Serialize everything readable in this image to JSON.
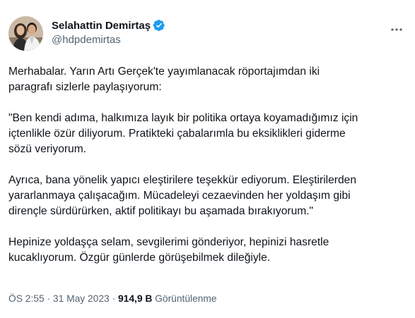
{
  "user": {
    "display_name": "Selahattin Demirtaş",
    "handle": "@hdpdemirtas"
  },
  "tweet": {
    "paragraphs": [
      "Merhabalar. Yarın Artı Gerçek'te yayımlanacak röportajımdan iki\nparagrafı sizlerle paylaşıyorum:",
      "\"Ben kendi adıma, halkımıza layık bir politika ortaya koyamadığımız için\niçtenlikle özür diliyorum. Pratikteki çabalarımla bu eksiklikleri giderme\nsözü veriyorum.",
      "Ayrıca, bana yönelik yapıcı eleştirilere teşekkür ediyorum. Eleştirilerden\nyararlanmaya çalışacağım. Mücadeleyi cezaevinden her yoldaşım gibi\ndirençle sürdürürken, aktif politikayı bu aşamada bırakıyorum.\"",
      "Hepinize yoldaşça selam, sevgilerimi gönderiyor, hepinizi hasretle\nkucaklıyorum. Özgür günlerde görüşebilmek dileğiyle."
    ],
    "time": "ÖS 2:55",
    "separator": "·",
    "date": "31 May 2023",
    "views_count": "914,9 B",
    "views_label": "Görüntülenme"
  },
  "icons": {
    "verified": "verified-badge-icon",
    "more": "more-options-icon"
  },
  "colors": {
    "verified": "#1d9bf0",
    "text": "#0f1419",
    "secondary": "#536471"
  }
}
